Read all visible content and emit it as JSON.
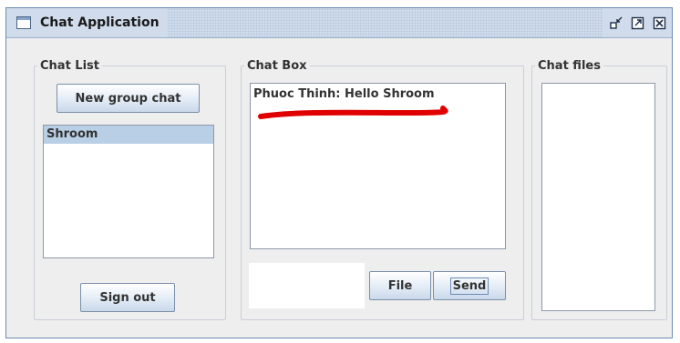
{
  "window": {
    "title": "Chat Application",
    "controls": [
      "minimize-icon",
      "maximize-icon",
      "close-icon"
    ]
  },
  "chat_list": {
    "legend": "Chat List",
    "new_group_label": "New group chat",
    "items": [
      {
        "label": "Shroom",
        "selected": true
      }
    ],
    "sign_out_label": "Sign out"
  },
  "chat_box": {
    "legend": "Chat Box",
    "messages": [
      {
        "text": "Phuoc Thinh: Hello Shroom"
      }
    ],
    "message_input_value": "",
    "file_label": "File",
    "send_label": "Send"
  },
  "chat_files": {
    "legend": "Chat files",
    "items": []
  },
  "colors": {
    "titlebar": "#d0dceb",
    "selection": "#b8cfe5",
    "annotation": "#e00000"
  }
}
